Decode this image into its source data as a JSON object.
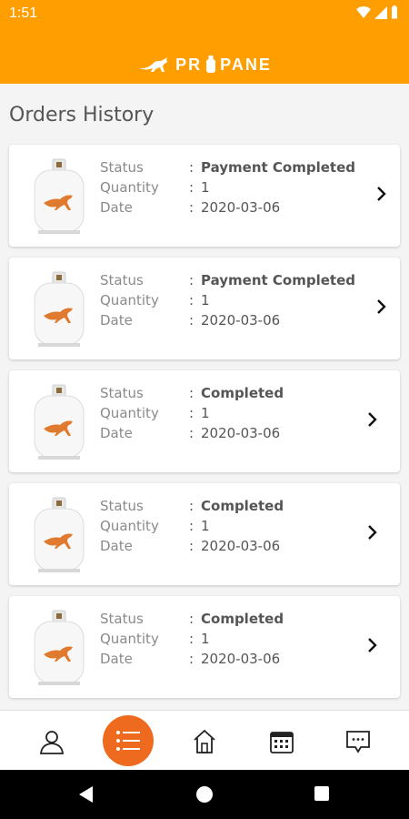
{
  "status_bar": {
    "time": "1:51"
  },
  "header": {
    "brand": "PR",
    "brand_rest": "PANE"
  },
  "page": {
    "title": "Orders History"
  },
  "orders": [
    {
      "status_label": "Status",
      "status": "Payment Completed",
      "quantity_label": "Quantity",
      "quantity": "1",
      "date_label": "Date",
      "date": "2020-03-06"
    },
    {
      "status_label": "Status",
      "status": "Payment Completed",
      "quantity_label": "Quantity",
      "quantity": "1",
      "date_label": "Date",
      "date": "2020-03-06"
    },
    {
      "status_label": "Status",
      "status": "Completed",
      "quantity_label": "Quantity",
      "quantity": "1",
      "date_label": "Date",
      "date": "2020-03-06"
    },
    {
      "status_label": "Status",
      "status": "Completed",
      "quantity_label": "Quantity",
      "quantity": "1",
      "date_label": "Date",
      "date": "2020-03-06"
    },
    {
      "status_label": "Status",
      "status": "Completed",
      "quantity_label": "Quantity",
      "quantity": "1",
      "date_label": "Date",
      "date": "2020-03-06"
    }
  ],
  "separator": ":",
  "bottom_nav": [
    {
      "icon": "profile-icon"
    },
    {
      "icon": "orders-list-icon",
      "active": true
    },
    {
      "icon": "home-icon"
    },
    {
      "icon": "calendar-icon"
    },
    {
      "icon": "chat-icon"
    }
  ],
  "colors": {
    "brand_orange": "#ff9e00",
    "active_nav": "#ee6a1e"
  }
}
